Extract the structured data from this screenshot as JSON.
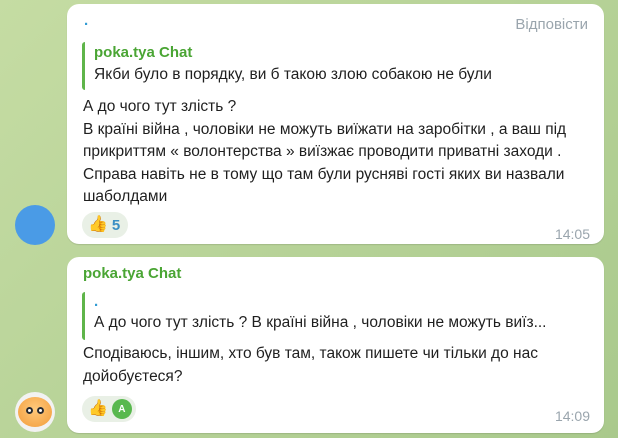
{
  "messages": [
    {
      "sender_marker": ".",
      "reply_action_label": "Відповісти",
      "reply": {
        "author": "poka.tya Chat",
        "text": "Якби було в порядку, ви б такою злою собакою не були"
      },
      "text": "А до чого тут злість ?\nВ країні війна , чоловіки не можуть виїжати на заробітки , а ваш під прикриттям « волонтерства » виїзжає проводити приватні заходи . Справа навіть не в тому що там були русняві гості яких ви назвали шаболдами",
      "reaction": {
        "emoji": "👍",
        "count": "5"
      },
      "time": "14:05"
    },
    {
      "author": "poka.tya Chat",
      "reply": {
        "author": ".",
        "text": "А до чого тут злість ?  В країні війна , чоловіки не можуть виїз..."
      },
      "text": "Сподіваюсь, іншим, хто був там, також пишете чи тільки до нас дойобуєтеся?",
      "reaction": {
        "emoji": "👍",
        "reactor_initial": "A"
      },
      "time": "14:09"
    }
  ],
  "colors": {
    "accent_name": "#4aa534",
    "link": "#2f9bd3",
    "bubble": "#ffffff",
    "background": "#b9d39a"
  }
}
